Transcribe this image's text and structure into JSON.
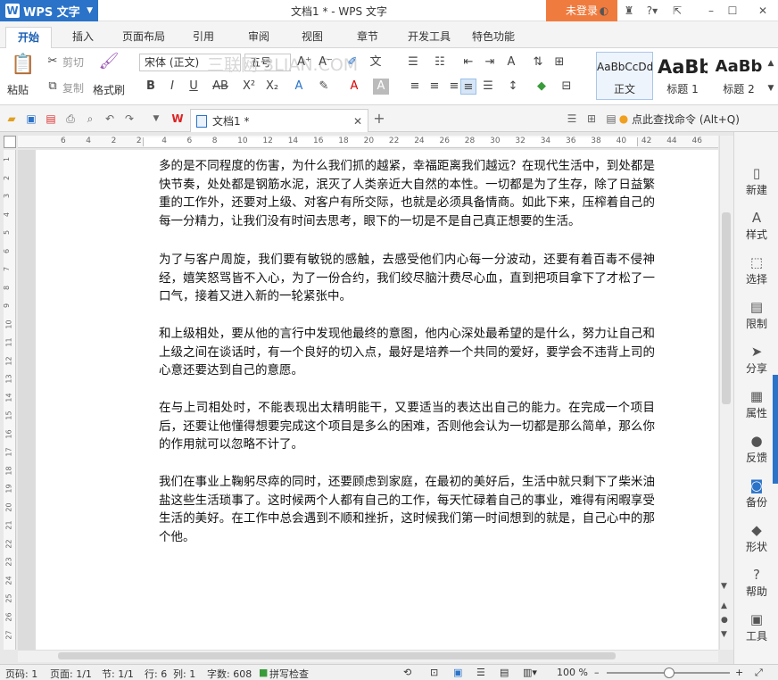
{
  "titlebar": {
    "app_name": "WPS 文字",
    "title": "文档1 * - WPS 文字",
    "login": "未登录"
  },
  "ribbon_tabs": [
    "开始",
    "插入",
    "页面布局",
    "引用",
    "审阅",
    "视图",
    "章节",
    "开发工具",
    "特色功能"
  ],
  "clipboard": {
    "paste": "粘贴",
    "cut": "剪切",
    "copy": "复制",
    "format_painter": "格式刷"
  },
  "font": {
    "family": "宋体 (正文)",
    "size": "五号"
  },
  "styles": [
    {
      "preview": "AaBbCcDd",
      "name": "正文"
    },
    {
      "preview": "AaBb",
      "name": "标题 1"
    },
    {
      "preview": "AaBb",
      "name": "标题 2"
    }
  ],
  "watermark": "三联网 3LIAN.COM",
  "quick_access": {
    "doc_tab": "文档1 *",
    "help_command": "点此查找命令 (Alt+Q)"
  },
  "ruler_ticks": [
    "6",
    "4",
    "2",
    "2",
    "4",
    "6",
    "8",
    "10",
    "12",
    "14",
    "16",
    "18",
    "20",
    "22",
    "24",
    "26",
    "28",
    "30",
    "32",
    "34",
    "36",
    "38",
    "40",
    "42",
    "44",
    "46"
  ],
  "vruler_ticks": [
    "1",
    "2",
    "3",
    "4",
    "5",
    "6",
    "7",
    "8",
    "9",
    "10",
    "11",
    "12",
    "13",
    "14",
    "15",
    "16",
    "17",
    "18",
    "19",
    "20",
    "21",
    "22",
    "23",
    "24",
    "25",
    "26",
    "27"
  ],
  "document": {
    "paragraphs": [
      "多的是不同程度的伤害，为什么我们抓的越紧，幸福距离我们越远？在现代生活中，到处都是快节奏，处处都是钢筋水泥，泯灭了人类亲近大自然的本性。一切都是为了生存，除了日益繁重的工作外，还要对上级、对客户有所交际，也就是必须具备情商。如此下来，压榨着自己的每一分精力，让我们没有时间去思考，眼下的一切是不是自己真正想要的生活。",
      "为了与客户周旋，我们要有敏锐的感触，去感受他们内心每一分波动，还要有着百毒不侵神经，嬉笑怒骂皆不入心，为了一份合约，我们绞尽脑汁费尽心血，直到把项目拿下了才松了一口气，接着又进入新的一轮紧张中。",
      "和上级相处，要从他的言行中发现他最终的意图，他内心深处最希望的是什么，努力让自己和上级之间在谈话时，有一个良好的切入点，最好是培养一个共同的爱好，要学会不违背上司的心意还要达到自己的意愿。",
      "在与上司相处时，不能表现出太精明能干，又要适当的表达出自己的能力。在完成一个项目后，还要让他懂得想要完成这个项目是多么的困难，否则他会认为一切都是那么简单，那么你的作用就可以忽略不计了。",
      "我们在事业上鞠躬尽瘁的同时，还要顾虑到家庭，在最初的美好后，生活中就只剩下了柴米油盐这些生活琐事了。这时候两个人都有自己的工作，每天忙碌着自己的事业，难得有闲暇享受生活的美好。在工作中总会遇到不顺和挫折，这时候我们第一时间想到的就是，自己心中的那个他。"
    ]
  },
  "side_panel": [
    "新建",
    "样式",
    "选择",
    "限制",
    "分享",
    "属性",
    "反馈",
    "备份",
    "形状",
    "帮助",
    "工具"
  ],
  "status": {
    "page_code": "页码: 1",
    "pages": "页面: 1/1",
    "section": "节: 1/1",
    "row": "行: 6",
    "col": "列: 1",
    "words": "字数: 608",
    "spell": "拼写检查",
    "zoom": "100 %"
  },
  "colors": {
    "accent": "#2a73c9",
    "login": "#f07b3f"
  }
}
